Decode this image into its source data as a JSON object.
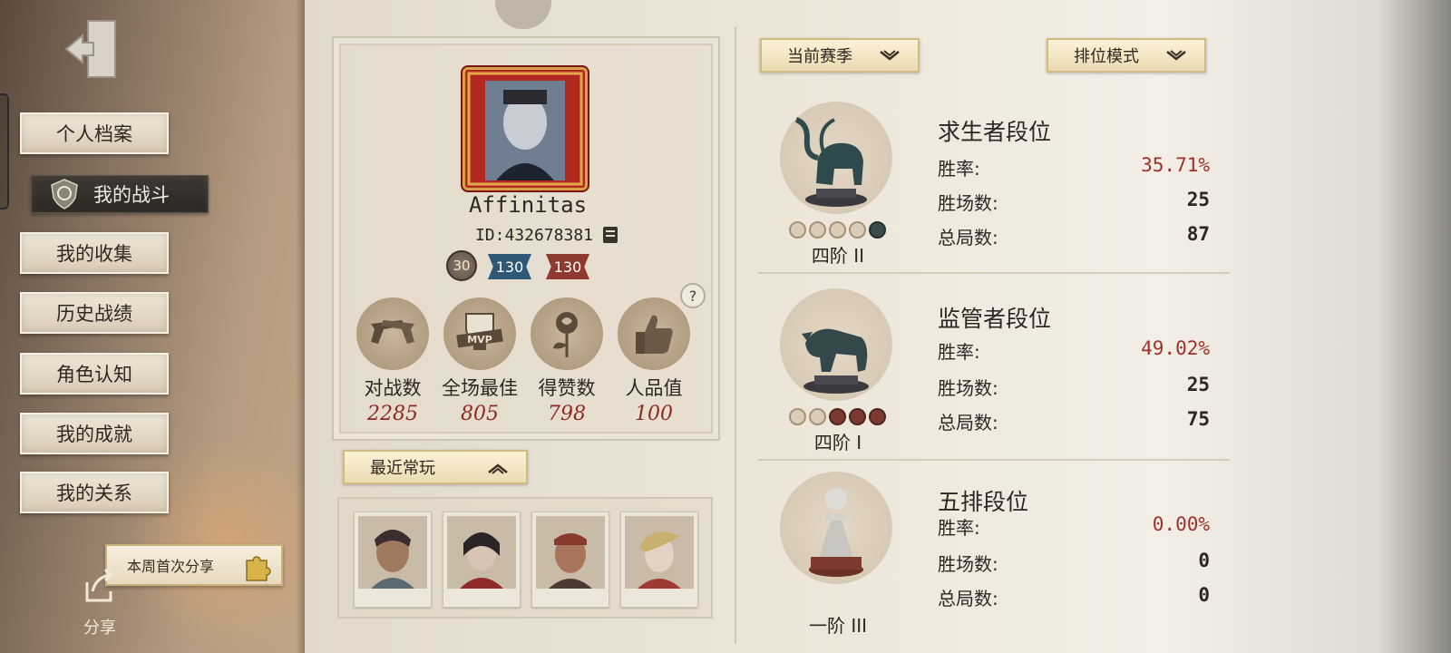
{
  "sidebar": {
    "nav": [
      {
        "label": "个人档案"
      },
      {
        "label": "我的战斗"
      },
      {
        "label": "我的收集"
      },
      {
        "label": "历史战绩"
      },
      {
        "label": "角色认知"
      },
      {
        "label": "我的成就"
      },
      {
        "label": "我的关系"
      }
    ],
    "share_banner": "本周首次分享",
    "share_label": "分享"
  },
  "profile": {
    "username": "Affinitas",
    "id": "ID:432678381",
    "level": "30",
    "badge_blue": "130",
    "badge_red": "130",
    "help": "?",
    "stats": [
      {
        "label": "对战数",
        "value": "2285",
        "icon": "pistols-icon"
      },
      {
        "label": "全场最佳",
        "value": "805",
        "icon": "mvp-trophy-icon"
      },
      {
        "label": "得赞数",
        "value": "798",
        "icon": "rose-icon"
      },
      {
        "label": "人品值",
        "value": "100",
        "icon": "thumbs-up-icon"
      }
    ]
  },
  "recent": {
    "dropdown_label": "最近常玩",
    "characters": [
      "character-1",
      "character-2",
      "character-3",
      "character-4"
    ]
  },
  "filters": {
    "season": "当前赛季",
    "mode": "排位模式"
  },
  "ranks": [
    {
      "title": "求生者段位",
      "tier": "四阶 II",
      "trophy": "mammoth-icon",
      "win_rate_label": "胜率:",
      "win_rate": "35.71%",
      "wins_label": "胜场数:",
      "wins": "25",
      "total_label": "总局数:",
      "total": "87"
    },
    {
      "title": "监管者段位",
      "tier": "四阶 I",
      "trophy": "panther-icon",
      "win_rate_label": "胜率:",
      "win_rate": "49.02%",
      "wins_label": "胜场数:",
      "wins": "25",
      "total_label": "总局数:",
      "total": "75"
    },
    {
      "title": "五排段位",
      "tier": "一阶 III",
      "trophy": "chess-pawn-icon",
      "win_rate_label": "胜率:",
      "win_rate": "0.00%",
      "wins_label": "胜场数:",
      "wins": "0",
      "total_label": "总局数:",
      "total": "0"
    }
  ]
}
